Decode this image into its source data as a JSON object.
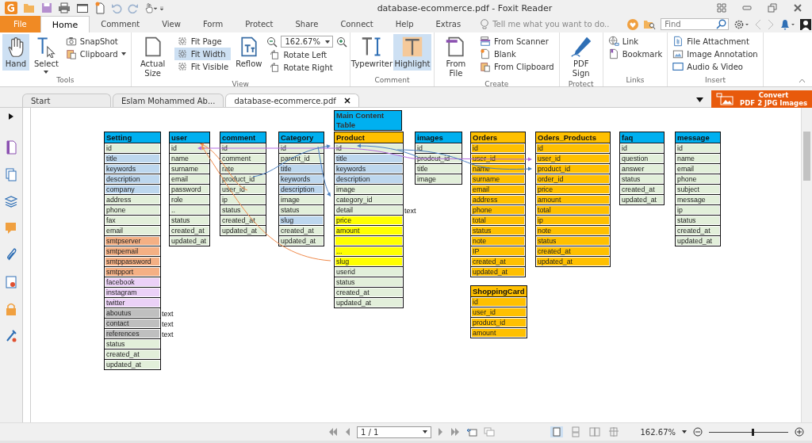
{
  "window": {
    "title": "database-ecommerce.pdf - Foxit Reader"
  },
  "ribbon_tabs": [
    {
      "label": "File",
      "kind": "file",
      "selected": false
    },
    {
      "label": "Home",
      "kind": "tab",
      "selected": true
    },
    {
      "label": "Comment",
      "kind": "tab",
      "selected": false
    },
    {
      "label": "View",
      "kind": "tab",
      "selected": false
    },
    {
      "label": "Form",
      "kind": "tab",
      "selected": false
    },
    {
      "label": "Protect",
      "kind": "tab",
      "selected": false
    },
    {
      "label": "Share",
      "kind": "tab",
      "selected": false
    },
    {
      "label": "Connect",
      "kind": "tab",
      "selected": false
    },
    {
      "label": "Help",
      "kind": "tab",
      "selected": false
    },
    {
      "label": "Extras",
      "kind": "tab",
      "selected": false
    }
  ],
  "tell_me": {
    "placeholder": "Tell me what you want to do.."
  },
  "find": {
    "placeholder": "Find"
  },
  "ribbon_groups": [
    {
      "label": "Tools",
      "items": [
        {
          "label": "Hand",
          "kind": "large",
          "selected": true,
          "dropdown": false
        },
        {
          "label": "Select",
          "kind": "large",
          "selected": false,
          "dropdown": true
        },
        {
          "label": "SnapShot",
          "kind": "small",
          "selected": false,
          "dropdown": false
        },
        {
          "label": "Clipboard",
          "kind": "small",
          "selected": false,
          "dropdown": true
        }
      ]
    },
    {
      "label": "View",
      "items": [
        {
          "label": "Actual Size",
          "kind": "large",
          "selected": false,
          "dropdown": false
        },
        {
          "label": "Fit Page",
          "kind": "small",
          "selected": false,
          "dropdown": false
        },
        {
          "label": "Fit Width",
          "kind": "small",
          "selected": true,
          "dropdown": false
        },
        {
          "label": "Fit Visible",
          "kind": "small",
          "selected": false,
          "dropdown": false
        },
        {
          "label": "Reflow",
          "kind": "large",
          "selected": false,
          "dropdown": false
        },
        {
          "label": "162.67%",
          "kind": "zoom",
          "selected": false,
          "dropdown": true
        },
        {
          "label": "Rotate Left",
          "kind": "small",
          "selected": false,
          "dropdown": false
        },
        {
          "label": "Rotate Right",
          "kind": "small",
          "selected": false,
          "dropdown": false
        }
      ]
    },
    {
      "label": "Comment",
      "items": [
        {
          "label": "Typewriter",
          "kind": "large",
          "selected": false,
          "dropdown": false
        },
        {
          "label": "Highlight",
          "kind": "large",
          "selected": true,
          "dropdown": false
        }
      ]
    },
    {
      "label": "Create",
      "items": [
        {
          "label": "From File",
          "kind": "large",
          "selected": false,
          "dropdown": false
        },
        {
          "label": "From Scanner",
          "kind": "small",
          "selected": false,
          "dropdown": false
        },
        {
          "label": "Blank",
          "kind": "small",
          "selected": false,
          "dropdown": false
        },
        {
          "label": "From Clipboard",
          "kind": "small",
          "selected": false,
          "dropdown": false
        }
      ]
    },
    {
      "label": "Protect",
      "items": [
        {
          "label": "PDF Sign",
          "kind": "large",
          "selected": false,
          "dropdown": false
        }
      ]
    },
    {
      "label": "Links",
      "items": [
        {
          "label": "Link",
          "kind": "small",
          "selected": false,
          "dropdown": false
        },
        {
          "label": "Bookmark",
          "kind": "small",
          "selected": false,
          "dropdown": false
        }
      ]
    },
    {
      "label": "Insert",
      "items": [
        {
          "label": "File Attachment",
          "kind": "small",
          "selected": false,
          "dropdown": false
        },
        {
          "label": "Image Annotation",
          "kind": "small",
          "selected": false,
          "dropdown": false
        },
        {
          "label": "Audio & Video",
          "kind": "small",
          "selected": false,
          "dropdown": false
        }
      ]
    }
  ],
  "doc_tabs": [
    {
      "label": "Start",
      "selected": false,
      "closable": false
    },
    {
      "label": "Eslam Mohammed Ab...",
      "selected": false,
      "closable": false
    },
    {
      "label": "database-ecommerce.pdf",
      "selected": true,
      "closable": true
    }
  ],
  "convert_button": {
    "line1": "Convert",
    "line2": "PDF 2 JPG Images"
  },
  "tables": [
    {
      "title": "Setting",
      "color": "#00b0f0",
      "fields": [
        {
          "name": "id",
          "color": "#e2efda"
        },
        {
          "name": "title",
          "color": "#bdd7ee"
        },
        {
          "name": "keywords",
          "color": "#bdd7ee"
        },
        {
          "name": "description",
          "color": "#bdd7ee"
        },
        {
          "name": "company",
          "color": "#bdd7ee"
        },
        {
          "name": "address",
          "color": "#e2efda"
        },
        {
          "name": "phone",
          "color": "#e2efda"
        },
        {
          "name": "fax",
          "color": "#e2efda"
        },
        {
          "name": "email",
          "color": "#e2efda"
        },
        {
          "name": "smtpserver",
          "color": "#f4b084"
        },
        {
          "name": "smtpemail",
          "color": "#f4b084"
        },
        {
          "name": "smtppassword",
          "color": "#f4b084"
        },
        {
          "name": "smtpport",
          "color": "#f4b084"
        },
        {
          "name": "facebook",
          "color": "#ebd1f7"
        },
        {
          "name": "instagram",
          "color": "#ebd1f7"
        },
        {
          "name": "twitter",
          "color": "#ebd1f7"
        },
        {
          "name": "aboutus",
          "color": "#bfbfbf",
          "note": "text"
        },
        {
          "name": "contact",
          "color": "#bfbfbf",
          "note": "text"
        },
        {
          "name": "references",
          "color": "#bfbfbf",
          "note": "text"
        },
        {
          "name": "status",
          "color": "#e2efda"
        },
        {
          "name": "created_at",
          "color": "#e2efda"
        },
        {
          "name": "updated_at",
          "color": "#e2efda"
        }
      ]
    },
    {
      "title": "user",
      "color": "#00b0f0",
      "fields": [
        {
          "name": "id",
          "color": "#e2efda"
        },
        {
          "name": "name",
          "color": "#e2efda"
        },
        {
          "name": "surname",
          "color": "#e2efda"
        },
        {
          "name": "email",
          "color": "#e2efda"
        },
        {
          "name": "password",
          "color": "#e2efda"
        },
        {
          "name": "role",
          "color": "#e2efda"
        },
        {
          "name": "..",
          "color": "#e2efda"
        },
        {
          "name": "status",
          "color": "#e2efda"
        },
        {
          "name": "created_at",
          "color": "#e2efda"
        },
        {
          "name": "updated_at",
          "color": "#e2efda"
        }
      ]
    },
    {
      "title": "comment",
      "color": "#00b0f0",
      "fields": [
        {
          "name": "id",
          "color": "#e2efda"
        },
        {
          "name": "comment",
          "color": "#e2efda"
        },
        {
          "name": "rate",
          "color": "#e2efda"
        },
        {
          "name": "product_id",
          "color": "#e2efda"
        },
        {
          "name": "user_id",
          "color": "#e2efda"
        },
        {
          "name": "ip",
          "color": "#e2efda"
        },
        {
          "name": "status",
          "color": "#e2efda"
        },
        {
          "name": "created_at",
          "color": "#e2efda"
        },
        {
          "name": "updated_at",
          "color": "#e2efda"
        }
      ]
    },
    {
      "title": "Category",
      "color": "#00b0f0",
      "fields": [
        {
          "name": "id",
          "color": "#e2efda"
        },
        {
          "name": "parent_id",
          "color": "#e2efda"
        },
        {
          "name": "title",
          "color": "#bdd7ee"
        },
        {
          "name": "keywords",
          "color": "#bdd7ee"
        },
        {
          "name": "description",
          "color": "#bdd7ee"
        },
        {
          "name": "image",
          "color": "#e2efda"
        },
        {
          "name": "status",
          "color": "#e2efda"
        },
        {
          "name": "slug",
          "color": "#bdd7ee"
        },
        {
          "name": "created_at",
          "color": "#e2efda"
        },
        {
          "name": "updated_at",
          "color": "#e2efda"
        }
      ]
    },
    {
      "caption": "Main Content Table",
      "title": "Product",
      "color": "#ffc000",
      "fields": [
        {
          "name": "id",
          "color": "#e2efda"
        },
        {
          "name": "title",
          "color": "#bdd7ee"
        },
        {
          "name": "keywords",
          "color": "#bdd7ee"
        },
        {
          "name": "description",
          "color": "#bdd7ee"
        },
        {
          "name": "image",
          "color": "#e2efda"
        },
        {
          "name": "category_id",
          "color": "#e2efda"
        },
        {
          "name": "detail",
          "color": "#e2efda",
          "note": "text"
        },
        {
          "name": "price",
          "color": "#ffff00"
        },
        {
          "name": "amount",
          "color": "#ffff00"
        },
        {
          "color": "#ffff00"
        },
        {
          "name": "...",
          "color": "#ffff00"
        },
        {
          "name": "slug",
          "color": "#ffff00"
        },
        {
          "name": "userid",
          "color": "#e2efda"
        },
        {
          "name": "status",
          "color": "#e2efda"
        },
        {
          "name": "created_at",
          "color": "#e2efda"
        },
        {
          "name": "updated_at",
          "color": "#e2efda"
        }
      ]
    },
    {
      "title": "images",
      "color": "#00b0f0",
      "fields": [
        {
          "name": "id",
          "color": "#e2efda"
        },
        {
          "name": "prodcut_id",
          "color": "#e2efda"
        },
        {
          "name": "title",
          "color": "#e2efda"
        },
        {
          "name": "image",
          "color": "#e2efda"
        }
      ]
    },
    {
      "title": "Orders",
      "color": "#ffc000",
      "fields": [
        {
          "name": "id",
          "color": "#ffc000"
        },
        {
          "name": "user_id",
          "color": "#ffc000"
        },
        {
          "name": "name",
          "color": "#ffc000"
        },
        {
          "name": "surname",
          "color": "#ffc000"
        },
        {
          "name": "email",
          "color": "#ffc000"
        },
        {
          "name": "address",
          "color": "#ffc000"
        },
        {
          "name": "phone",
          "color": "#ffc000"
        },
        {
          "name": "total",
          "color": "#ffc000"
        },
        {
          "name": "status",
          "color": "#ffc000"
        },
        {
          "name": "note",
          "color": "#ffc000"
        },
        {
          "name": "IP",
          "color": "#ffc000"
        },
        {
          "name": "created_at",
          "color": "#ffc000"
        },
        {
          "name": "updated_at",
          "color": "#ffc000"
        }
      ]
    },
    {
      "title": "Oders_Products",
      "color": "#ffc000",
      "fields": [
        {
          "name": "id",
          "color": "#ffc000"
        },
        {
          "name": "user_id",
          "color": "#ffc000"
        },
        {
          "name": "product_id",
          "color": "#ffc000"
        },
        {
          "name": "order_id",
          "color": "#ffc000"
        },
        {
          "name": "price",
          "color": "#ffc000"
        },
        {
          "name": "amount",
          "color": "#ffc000"
        },
        {
          "name": "total",
          "color": "#ffc000"
        },
        {
          "name": "ip",
          "color": "#ffc000"
        },
        {
          "name": "note",
          "color": "#ffc000"
        },
        {
          "name": "status",
          "color": "#ffc000"
        },
        {
          "name": "created_at",
          "color": "#ffc000"
        },
        {
          "name": "updated_at",
          "color": "#ffc000"
        }
      ]
    },
    {
      "title": "faq",
      "color": "#00b0f0",
      "fields": [
        {
          "name": "id",
          "color": "#e2efda"
        },
        {
          "name": "question",
          "color": "#e2efda"
        },
        {
          "name": "answer",
          "color": "#e2efda"
        },
        {
          "name": "status",
          "color": "#e2efda"
        },
        {
          "name": "created_at",
          "color": "#e2efda"
        },
        {
          "name": "updated_at",
          "color": "#e2efda"
        }
      ]
    },
    {
      "title": "message",
      "color": "#00b0f0",
      "fields": [
        {
          "name": "id",
          "color": "#e2efda"
        },
        {
          "name": "name",
          "color": "#e2efda"
        },
        {
          "name": "email",
          "color": "#e2efda"
        },
        {
          "name": "phone",
          "color": "#e2efda"
        },
        {
          "name": "subject",
          "color": "#e2efda"
        },
        {
          "name": "message",
          "color": "#e2efda"
        },
        {
          "name": "ip",
          "color": "#e2efda"
        },
        {
          "name": "status",
          "color": "#e2efda"
        },
        {
          "name": "created_at",
          "color": "#e2efda"
        },
        {
          "name": "updated_at",
          "color": "#e2efda"
        }
      ]
    },
    {
      "title": "ShoppingCard",
      "color": "#ffc000",
      "fields": [
        {
          "name": "id",
          "color": "#ffc000"
        },
        {
          "name": "user_id",
          "color": "#ffc000"
        },
        {
          "name": "product_id",
          "color": "#ffc000"
        },
        {
          "name": "amount",
          "color": "#ffc000"
        }
      ]
    }
  ],
  "status_bar": {
    "page": "1 / 1",
    "zoom": "162.67%",
    "zoom_slider": {
      "level": 0.54
    }
  }
}
